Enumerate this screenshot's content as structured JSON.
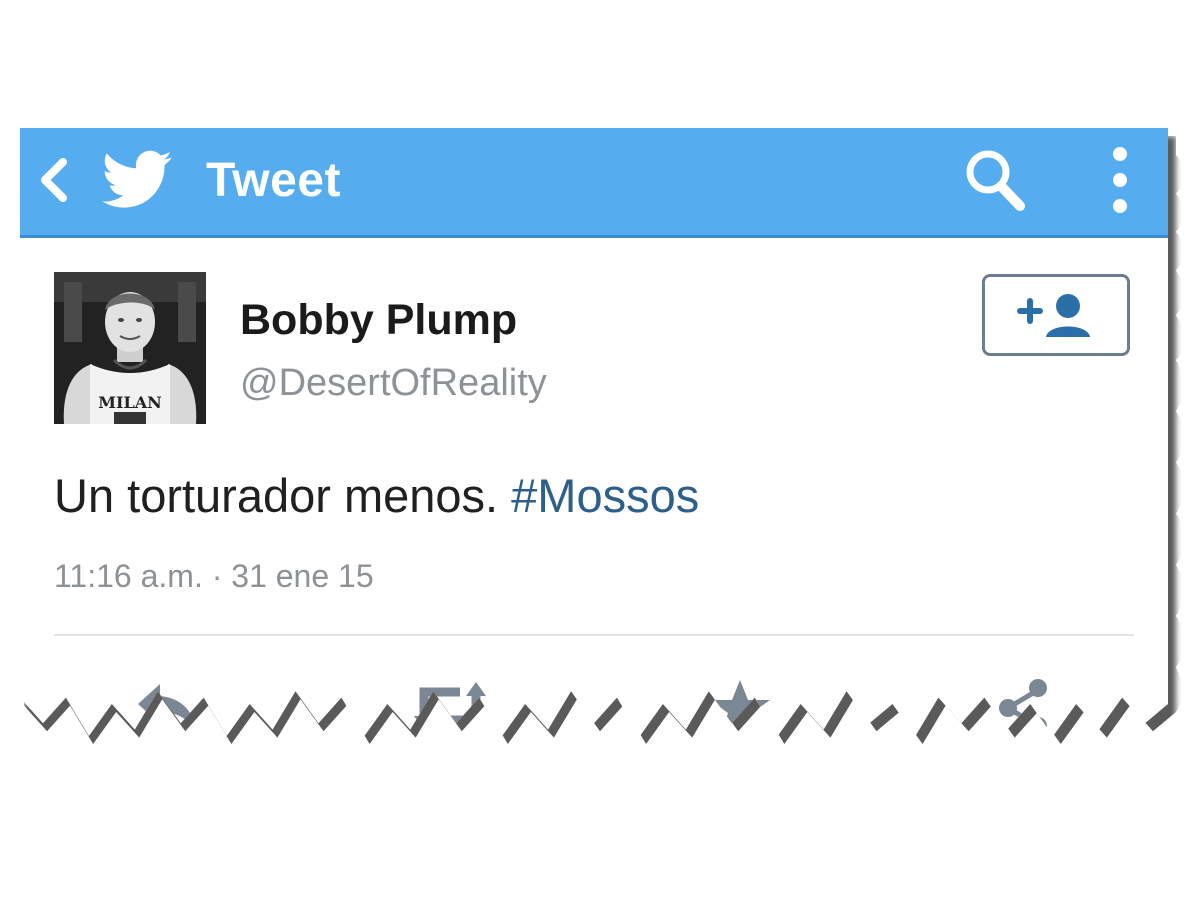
{
  "actionbar": {
    "title": "Tweet",
    "color": "#55acee",
    "icons": [
      "back-icon",
      "twitter-bird-icon",
      "search-icon",
      "overflow-menu-icon"
    ]
  },
  "tweet": {
    "display_name": "Bobby Plump",
    "handle": "@DesertOfReality",
    "text": "Un torturador menos. ",
    "hashtag": "#Mossos",
    "timestamp": "11:16 a.m. · 31 ene 15",
    "avatar_jersey_text": "MILAN",
    "hashtag_color": "#2c5f8a"
  },
  "follow_button": {
    "icon": "follow-plus-person-icon"
  },
  "actions": {
    "icons": [
      "reply-icon",
      "retweet-icon",
      "favorite-star-icon",
      "share-icon"
    ],
    "icon_color": "#7b8794"
  }
}
